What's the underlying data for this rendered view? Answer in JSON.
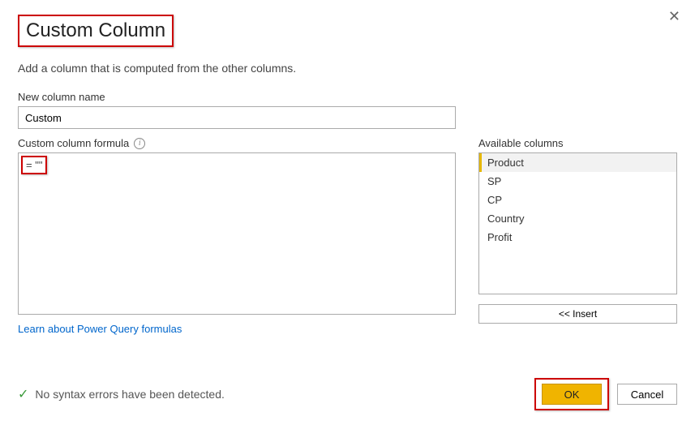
{
  "dialog": {
    "title": "Custom Column",
    "subtitle": "Add a column that is computed from the other columns."
  },
  "newColumn": {
    "label": "New column name",
    "value": "Custom"
  },
  "formula": {
    "label": "Custom column formula",
    "content": "=  \"\""
  },
  "available": {
    "label": "Available columns",
    "items": [
      "Product",
      "SP",
      "CP",
      "Country",
      "Profit"
    ],
    "selectedIndex": 0,
    "insertLabel": "<< Insert"
  },
  "link": {
    "text": "Learn about Power Query formulas"
  },
  "status": {
    "text": "No syntax errors have been detected."
  },
  "buttons": {
    "ok": "OK",
    "cancel": "Cancel"
  }
}
